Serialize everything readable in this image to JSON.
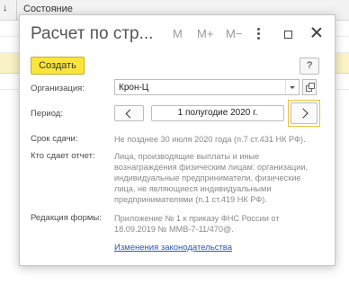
{
  "background": {
    "sort_icon": "↓",
    "column_header": "Состояние"
  },
  "dialog": {
    "title": "Расчет по стр...",
    "titlebar": {
      "m": "M",
      "m_plus": "M+",
      "m_minus": "M−"
    },
    "toolbar": {
      "create_label": "Создать",
      "help_label": "?"
    },
    "organization": {
      "label": "Организация:",
      "value": "Крон-Ц"
    },
    "period": {
      "label": "Период:",
      "value": "1 полугодие 2020 г."
    },
    "due": {
      "label": "Срок сдачи:",
      "value": "Не позднее 30 июля 2020 года (п.7 ст.431 НК РФ)."
    },
    "submitter": {
      "label": "Кто сдает отчет:",
      "value": "Лица, производящие выплаты и иные вознаграждения физическим лицам: организации, индивидуальные предприниматели, физические лица, не являющиеся индивидуальными предпринимателями (п.1 ст.419 НК РФ)."
    },
    "edition": {
      "label": "Редакция формы:",
      "value": "Приложение № 1 к приказу ФНС России от 18.09.2019 № ММВ-7-11/470@."
    },
    "law_changes_link": "Изменения законодательства"
  },
  "colors": {
    "accent_yellow": "#fbe53b",
    "focus_border": "#f0c238",
    "link": "#2a5aa8",
    "row_highlight": "#fbf2c6"
  },
  "icons": [
    "sort-arrow-icon",
    "more-vertical-icon",
    "maximize-icon",
    "close-icon",
    "dropdown-arrow-icon",
    "open-form-icon",
    "chevron-left-icon",
    "chevron-right-icon"
  ]
}
